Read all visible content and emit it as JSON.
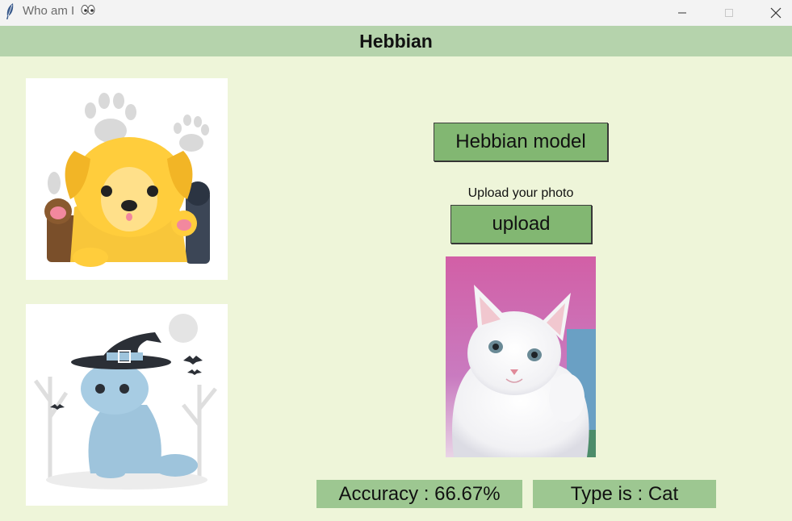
{
  "window": {
    "title": "Who am I",
    "icons": {
      "app": "feather-icon",
      "title_emoji": "eyes-icon",
      "minimize": "minimize-icon",
      "maximize": "maximize-icon",
      "close": "close-icon"
    }
  },
  "header": {
    "title": "Hebbian"
  },
  "sidebar": {
    "images": [
      {
        "name": "dog-illustration"
      },
      {
        "name": "cat-witch-illustration"
      }
    ]
  },
  "main": {
    "model_button_label": "Hebbian model",
    "upload_prompt": "Upload your photo",
    "upload_button_label": "upload",
    "uploaded_image": "white-kitten-photo"
  },
  "results": {
    "accuracy": "Accuracy : 66.67%",
    "type": "Type is : Cat"
  },
  "colors": {
    "background": "#eef5d9",
    "header": "#b5d3ac",
    "button": "#82b772",
    "result_box": "#9dc791"
  }
}
